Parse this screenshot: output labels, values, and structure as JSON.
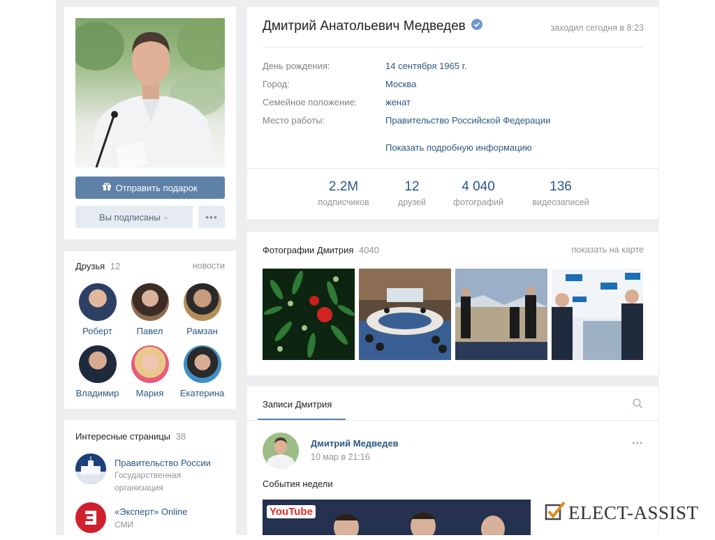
{
  "profile": {
    "name": "Дмитрий Анатольевич Медведев",
    "last_seen": "заходил сегодня в 8:23",
    "info": [
      {
        "label": "День рождения:",
        "value": "14 сентября 1965 г."
      },
      {
        "label": "Город:",
        "value": "Москва"
      },
      {
        "label": "Семейное положение:",
        "value": "женат"
      },
      {
        "label": "Место работы:",
        "value": "Правительство Российской Федерации"
      }
    ],
    "show_more": "Показать подробную информацию",
    "counters": [
      {
        "value": "2.2M",
        "label": "подписчиков"
      },
      {
        "value": "12",
        "label": "друзей"
      },
      {
        "value": "4 040",
        "label": "фотографий"
      },
      {
        "value": "136",
        "label": "видеозаписей"
      }
    ]
  },
  "actions": {
    "gift": "Отправить подарок",
    "subscribed": "Вы подписаны",
    "more": "•••"
  },
  "friends": {
    "title": "Друзья",
    "count": "12",
    "news_link": "новости",
    "items": [
      {
        "name": "Роберт"
      },
      {
        "name": "Павел"
      },
      {
        "name": "Рамзан"
      },
      {
        "name": "Владимир"
      },
      {
        "name": "Мария"
      },
      {
        "name": "Екатерина"
      }
    ]
  },
  "pages": {
    "title": "Интересные страницы",
    "count": "38",
    "items": [
      {
        "name": "Правительство России",
        "desc1": "Государственная",
        "desc2": "организация"
      },
      {
        "name": "«Эксперт» Online",
        "desc1": "СМИ"
      }
    ]
  },
  "photos": {
    "title": "Фотографии Дмитрия",
    "count": "4040",
    "map_link": "показать на карте"
  },
  "wall": {
    "tab": "Записи Дмитрия",
    "post": {
      "author": "Дмитрий Медведев",
      "date": "10 мар в 21:16",
      "text": "События недели",
      "more": "•••",
      "video_label": "YouTube"
    }
  },
  "watermark": "ELECT-ASSIST"
}
